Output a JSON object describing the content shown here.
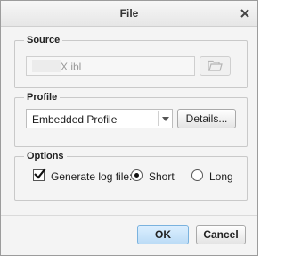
{
  "window": {
    "title": "File",
    "close_glyph": "✕"
  },
  "source": {
    "legend": "Source",
    "file_value": "X.ibl",
    "browse_icon": "folder-open-icon"
  },
  "profile": {
    "legend": "Profile",
    "selected": "Embedded Profile",
    "details_label": "Details..."
  },
  "options": {
    "legend": "Options",
    "generate_log_label": "Generate log file:",
    "generate_log_checked": true,
    "log_mode_options": [
      "Short",
      "Long"
    ],
    "log_mode_selected": "Short"
  },
  "footer": {
    "ok_label": "OK",
    "cancel_label": "Cancel"
  },
  "colors": {
    "ok_accent": "#cfe6f8",
    "ok_border": "#7ab2de"
  }
}
